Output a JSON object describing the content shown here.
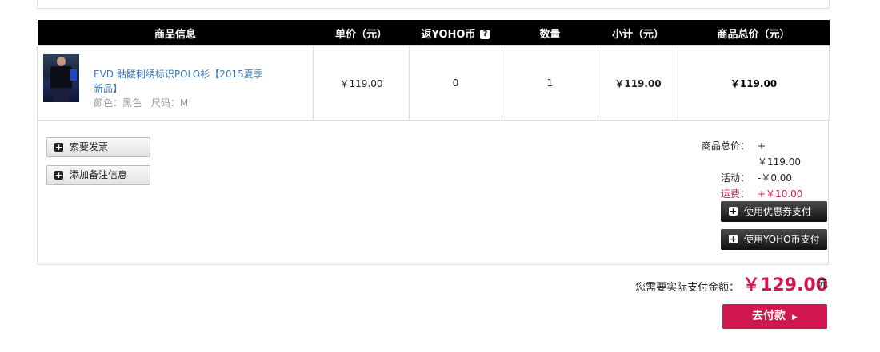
{
  "table": {
    "headers": [
      "商品信息",
      "单价（元）",
      "返YOHO币",
      "数量",
      "小计（元）",
      "商品总价（元）"
    ],
    "help_glyph": "?",
    "product": {
      "name": "EVD 骷髅刺绣标识POLO衫【2015夏季新品】",
      "color_label": "颜色：",
      "color": "黑色",
      "size_label": "尺码：",
      "size": "M",
      "unit_price": "￥119.00",
      "yoho_coins": "0",
      "quantity": "1",
      "subtotal": "￥119.00",
      "total": "￥119.00"
    }
  },
  "buttons": {
    "invoice": "索要发票",
    "remark": "添加备注信息",
    "use_coupon": "使用优惠券支付",
    "use_yoho_coin": "使用YOHO币支付",
    "pay": "去付款",
    "plus_glyph": "+",
    "arrow_glyph": "▶"
  },
  "summary": {
    "goods_total_label": "商品总价：",
    "goods_total": "+￥119.00",
    "activity_label": "活动：",
    "activity": "-￥0.00",
    "shipping_label": "运费：",
    "shipping": "+￥10.00"
  },
  "payment": {
    "label": "您需要实际支付金额：",
    "amount": "￥129.00",
    "unit": "元"
  },
  "colors": {
    "accent": "#d0174f",
    "header_bg": "#000000",
    "link": "#3a7bb7"
  }
}
